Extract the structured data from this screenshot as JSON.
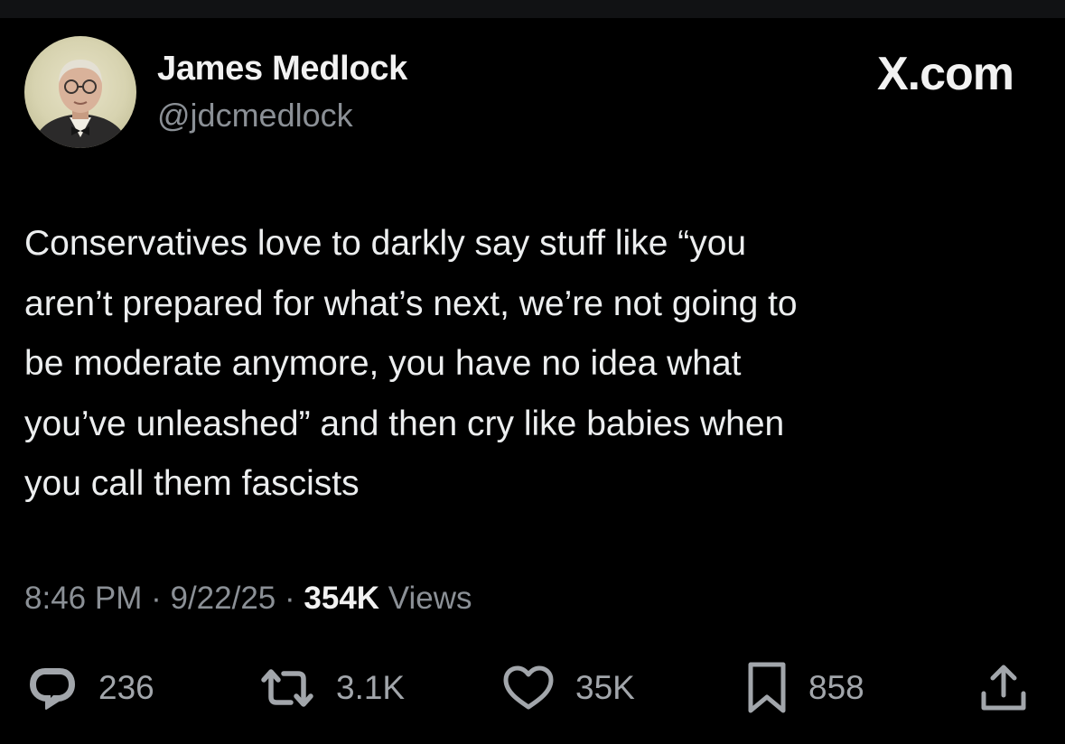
{
  "author": {
    "display_name": "James Medlock",
    "handle": "@jdcmedlock"
  },
  "site_mark": "X.com",
  "tweet": {
    "lines": [
      "Conservatives love to darkly say stuff like “you",
      "aren’t prepared for what’s next, we’re not going to",
      "be moderate anymore, you have no idea what",
      "you’ve unleashed” and then cry like babies when",
      "you call them fascists"
    ]
  },
  "meta": {
    "time": "8:46 PM",
    "date": "9/22/25",
    "separator": "·",
    "views_count": "354K",
    "views_label": "Views"
  },
  "actions": {
    "reply": {
      "icon": "reply-icon",
      "count": "236"
    },
    "repost": {
      "icon": "repost-icon",
      "count": "3.1K"
    },
    "like": {
      "icon": "heart-icon",
      "count": "35K"
    },
    "bookmark": {
      "icon": "bookmark-icon",
      "count": "858"
    },
    "share": {
      "icon": "share-icon"
    }
  },
  "colors": {
    "background": "#000000",
    "primary_text": "#eceeef",
    "secondary_text": "#8b9096",
    "icon": "#a2a6ab"
  }
}
